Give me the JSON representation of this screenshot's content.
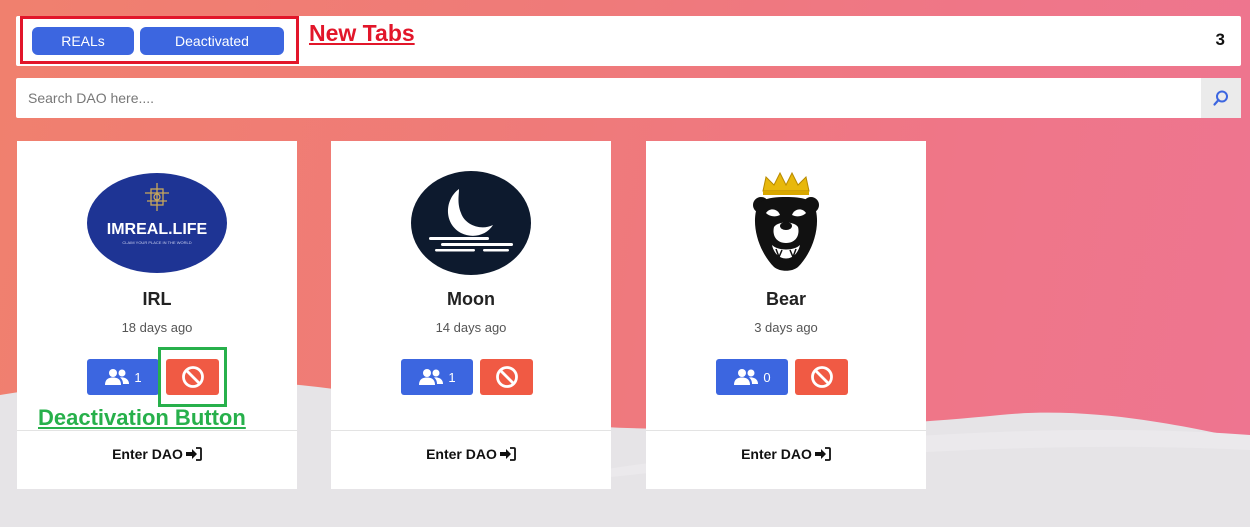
{
  "tabs": [
    {
      "label": "REALs"
    },
    {
      "label": "Deactivated"
    }
  ],
  "dao_count": "3",
  "search": {
    "placeholder": "Search DAO here...."
  },
  "annotations": {
    "tabs_note": "New Tabs",
    "button_note": "Deactivation Button",
    "tabs_color": "#e2162a",
    "button_color": "#27b04b"
  },
  "cards": [
    {
      "name": "IRL",
      "time": "18 days ago",
      "members": "1",
      "enter_label": "Enter DAO",
      "logo": "imreal-life-logo",
      "logo_text": "IMREAL.LIFE",
      "logo_subtext": "CLAIM YOUR PLACE IN THE WORLD"
    },
    {
      "name": "Moon",
      "time": "14 days ago",
      "members": "1",
      "enter_label": "Enter DAO",
      "logo": "moon-logo"
    },
    {
      "name": "Bear",
      "time": "3 days ago",
      "members": "0",
      "enter_label": "Enter DAO",
      "logo": "crowned-bear-logo"
    }
  ],
  "colors": {
    "primary": "#3c66e0",
    "danger": "#f05a44",
    "background_gradient": [
      "#f0806e",
      "#ee7590"
    ]
  }
}
